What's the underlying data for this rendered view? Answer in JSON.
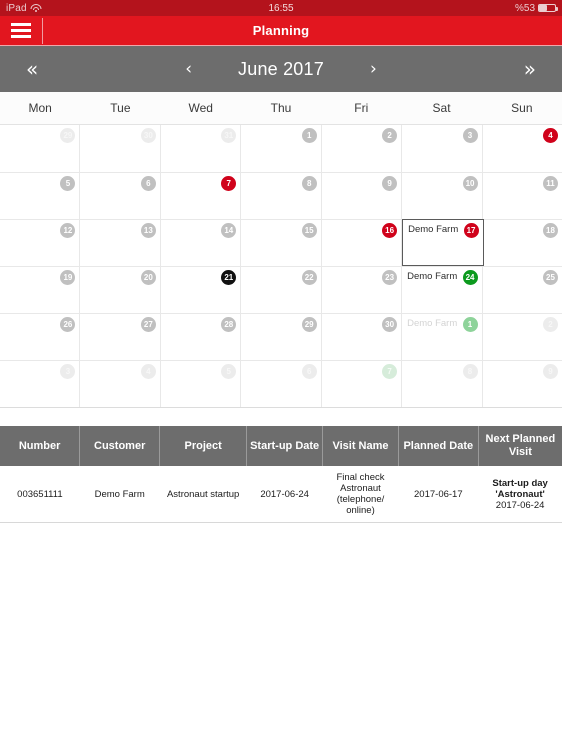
{
  "statusbar": {
    "device": "iPad",
    "wifi_icon": "wifi-icon",
    "time": "16:55",
    "battery_text": "%53",
    "battery_icon": "battery-icon",
    "battery_level": 53
  },
  "navbar": {
    "menu_icon": "hamburger-menu-icon",
    "title": "Planning"
  },
  "monthbar": {
    "prev_year": "«",
    "prev_month": "‹",
    "title": "June 2017",
    "next_month": "›",
    "next_year": "»"
  },
  "weekdays": [
    "Mon",
    "Tue",
    "Wed",
    "Thu",
    "Fri",
    "Sat",
    "Sun"
  ],
  "calendar": {
    "weeks": [
      [
        {
          "day": "29",
          "style": "dim",
          "event": ""
        },
        {
          "day": "30",
          "style": "dim",
          "event": ""
        },
        {
          "day": "31",
          "style": "dim",
          "event": ""
        },
        {
          "day": "1",
          "style": "gray",
          "event": ""
        },
        {
          "day": "2",
          "style": "gray",
          "event": ""
        },
        {
          "day": "3",
          "style": "gray",
          "event": ""
        },
        {
          "day": "4",
          "style": "red",
          "event": ""
        }
      ],
      [
        {
          "day": "5",
          "style": "gray",
          "event": ""
        },
        {
          "day": "6",
          "style": "gray",
          "event": ""
        },
        {
          "day": "7",
          "style": "red",
          "event": ""
        },
        {
          "day": "8",
          "style": "gray",
          "event": ""
        },
        {
          "day": "9",
          "style": "gray",
          "event": ""
        },
        {
          "day": "10",
          "style": "gray",
          "event": ""
        },
        {
          "day": "11",
          "style": "gray",
          "event": ""
        }
      ],
      [
        {
          "day": "12",
          "style": "gray",
          "event": ""
        },
        {
          "day": "13",
          "style": "gray",
          "event": ""
        },
        {
          "day": "14",
          "style": "gray",
          "event": ""
        },
        {
          "day": "15",
          "style": "gray",
          "event": ""
        },
        {
          "day": "16",
          "style": "red",
          "event": ""
        },
        {
          "day": "17",
          "style": "red",
          "event": "Demo Farm",
          "selected": true
        },
        {
          "day": "18",
          "style": "gray",
          "event": ""
        }
      ],
      [
        {
          "day": "19",
          "style": "gray",
          "event": ""
        },
        {
          "day": "20",
          "style": "gray",
          "event": ""
        },
        {
          "day": "21",
          "style": "black",
          "event": ""
        },
        {
          "day": "22",
          "style": "gray",
          "event": ""
        },
        {
          "day": "23",
          "style": "gray",
          "event": ""
        },
        {
          "day": "24",
          "style": "green",
          "event": "Demo Farm"
        },
        {
          "day": "25",
          "style": "gray",
          "event": ""
        }
      ],
      [
        {
          "day": "26",
          "style": "gray",
          "event": ""
        },
        {
          "day": "27",
          "style": "gray",
          "event": ""
        },
        {
          "day": "28",
          "style": "gray",
          "event": ""
        },
        {
          "day": "29",
          "style": "gray",
          "event": ""
        },
        {
          "day": "30",
          "style": "gray",
          "event": ""
        },
        {
          "day": "1",
          "style": "lightgreen",
          "event": "Demo Farm",
          "event_faded": true
        },
        {
          "day": "2",
          "style": "dim",
          "event": ""
        }
      ],
      [
        {
          "day": "3",
          "style": "dim",
          "event": ""
        },
        {
          "day": "4",
          "style": "dim",
          "event": ""
        },
        {
          "day": "5",
          "style": "dim",
          "event": ""
        },
        {
          "day": "6",
          "style": "dim",
          "event": ""
        },
        {
          "day": "7",
          "style": "palegreen",
          "event": ""
        },
        {
          "day": "8",
          "style": "dim",
          "event": ""
        },
        {
          "day": "9",
          "style": "dim",
          "event": ""
        }
      ]
    ]
  },
  "table": {
    "columns": [
      "Number",
      "Customer",
      "Project",
      "Start-up Date",
      "Visit Name",
      "Planned Date",
      "Next Planned Visit"
    ],
    "rows": [
      {
        "number": "003651111",
        "customer": "Demo Farm",
        "project": "Astronaut startup",
        "startup_date": "2017-06-24",
        "visit_name": "Final check Astronaut (telephone/ online)",
        "planned_date": "2017-06-17",
        "next_visit_bold": "Start-up day 'Astronaut'",
        "next_visit_date": "2017-06-24"
      }
    ]
  },
  "colors": {
    "brand_red": "#e2161f",
    "status_red": "#b4131c",
    "toolbar_gray": "#6d6d6d",
    "event_red": "#d0021b",
    "event_green": "#0c9a1e",
    "today_black": "#111111",
    "planned_date_red": "#e0262c"
  }
}
